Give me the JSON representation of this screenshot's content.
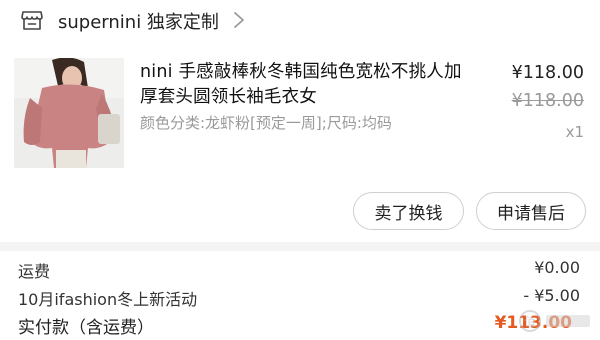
{
  "header": {
    "store_name": "supernini 独家定制",
    "store_icon": "store-icon",
    "chevron_icon": "chevron-right-icon"
  },
  "item": {
    "title": "nini 手感敲棒秋冬韩国纯色宽松不挑人加厚套头圆领长袖毛衣女",
    "sku": "颜色分类:龙虾粉[预定一周];尺码:均码",
    "price": "¥118.00",
    "original_price": "¥118.00",
    "quantity": "x1"
  },
  "actions": {
    "resell": "卖了换钱",
    "after_sale": "申请售后"
  },
  "summary": {
    "shipping_label": "运费",
    "shipping_value": "¥0.00",
    "promo_label": "10月ifashion冬上新活动",
    "promo_value": "- ¥5.00",
    "paid_label": "实付款（含运费）",
    "paid_value": "¥113.00"
  },
  "colors": {
    "accent": "#e55a1f",
    "muted_text": "#9a9a9a",
    "border": "#cfcfcf",
    "divider": "#f4f4f4"
  }
}
